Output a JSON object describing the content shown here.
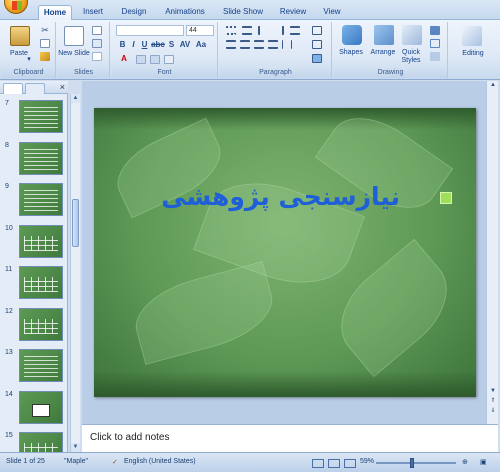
{
  "tabs": [
    "Home",
    "Insert",
    "Design",
    "Animations",
    "Slide Show",
    "Review",
    "View"
  ],
  "ribbon": {
    "clipboard": {
      "paste": "Paste",
      "label": "Clipboard"
    },
    "slides": {
      "new_slide": "New Slide",
      "label": "Slides"
    },
    "font": {
      "size": "44",
      "label": "Font",
      "b": "B",
      "i": "I",
      "u": "U",
      "s": "S",
      "abc": "abc",
      "av": "AV",
      "aa": "Aa",
      "a": "A"
    },
    "paragraph": {
      "label": "Paragraph"
    },
    "drawing": {
      "shapes": "Shapes",
      "arrange": "Arrange",
      "quick_styles": "Quick Styles",
      "label": "Drawing"
    },
    "editing": {
      "label": "Editing"
    }
  },
  "thumbnails": [
    {
      "num": "7",
      "kind": "text"
    },
    {
      "num": "8",
      "kind": "text"
    },
    {
      "num": "9",
      "kind": "text"
    },
    {
      "num": "10",
      "kind": "table"
    },
    {
      "num": "11",
      "kind": "table"
    },
    {
      "num": "12",
      "kind": "table"
    },
    {
      "num": "13",
      "kind": "text"
    },
    {
      "num": "14",
      "kind": "chart"
    },
    {
      "num": "15",
      "kind": "table"
    }
  ],
  "slide": {
    "title": "نیازسنجی پژوهشی"
  },
  "notes_placeholder": "Click to add notes",
  "status": {
    "slide": "Slide 1 of 25",
    "theme": "\"Maple\"",
    "language": "English (United States)",
    "zoom": "59%"
  },
  "colors": {
    "accent": "#15428b",
    "slide_green": "#5e9956",
    "title_blue": "#1f5fd8",
    "bullet": "#9ee05a"
  }
}
